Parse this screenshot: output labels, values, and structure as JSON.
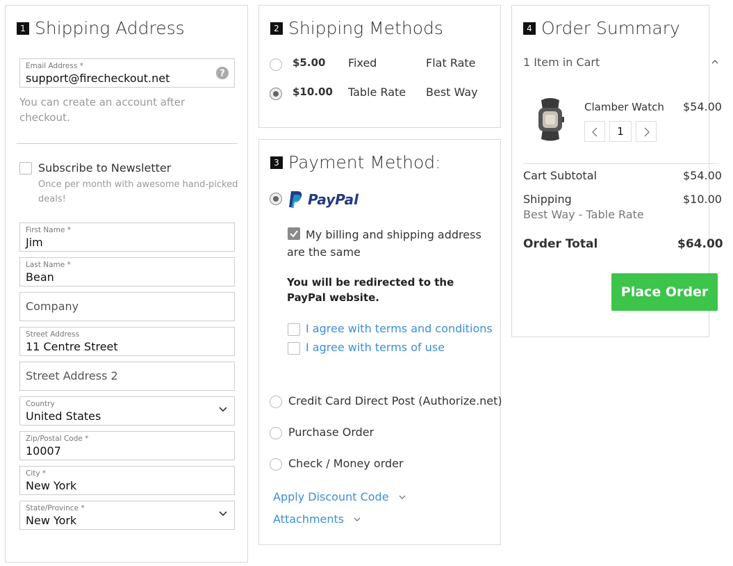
{
  "shipping_address": {
    "step": "1",
    "title": "Shipping Address",
    "email": {
      "label": "Email Address *",
      "value": "support@firecheckout.net"
    },
    "account_note": "You can create an account after checkout.",
    "newsletter": {
      "label": "Subscribe to Newsletter",
      "note": "Once per month with awesome hand-picked deals!"
    },
    "first_name": {
      "label": "First Name *",
      "value": "Jim"
    },
    "last_name": {
      "label": "Last Name *",
      "value": "Bean"
    },
    "company": {
      "placeholder": "Company"
    },
    "street": {
      "label": "Street Address",
      "value": "11 Centre Street"
    },
    "street2": {
      "placeholder": "Street Address 2"
    },
    "country": {
      "label": "Country",
      "value": "United States"
    },
    "zip": {
      "label": "Zip/Postal Code *",
      "value": "10007"
    },
    "city": {
      "label": "City *",
      "value": "New York"
    },
    "state": {
      "label": "State/Province *",
      "value": "New York"
    }
  },
  "shipping_methods": {
    "step": "2",
    "title": "Shipping Methods",
    "options": [
      {
        "price": "$5.00",
        "method": "Fixed",
        "carrier": "Flat Rate",
        "selected": false
      },
      {
        "price": "$10.00",
        "method": "Table Rate",
        "carrier": "Best Way",
        "selected": true
      }
    ]
  },
  "payment_method": {
    "step": "3",
    "title": "Payment Method:",
    "paypal": {
      "logo_text": "PayPal",
      "same_address": "My billing and shipping address are the same",
      "redirect_note": "You will be redirected to the PayPal website.",
      "agree_terms": "I agree with terms and conditions",
      "agree_use": "I agree with terms of use"
    },
    "other_methods": [
      "Credit Card Direct Post (Authorize.net)",
      "Purchase Order",
      "Check / Money order"
    ],
    "discount_link": "Apply Discount Code",
    "attachments_link": "Attachments"
  },
  "order_summary": {
    "step": "4",
    "title": "Order Summary",
    "cart_count": "1 Item in Cart",
    "item": {
      "name": "Clamber Watch",
      "price": "$54.00",
      "qty": "1"
    },
    "subtotal_label": "Cart Subtotal",
    "subtotal_value": "$54.00",
    "shipping_label": "Shipping",
    "shipping_detail": "Best Way - Table Rate",
    "shipping_value": "$10.00",
    "total_label": "Order Total",
    "total_value": "$64.00",
    "place_order": "Place Order"
  },
  "colors": {
    "accent_green": "#3cc44b",
    "link_blue": "#3d8ed8",
    "paypal_dark": "#253b80",
    "paypal_light": "#179bd7"
  },
  "icons": [
    "help-icon",
    "chevron-down-icon",
    "chevron-up-icon",
    "chevron-left-icon",
    "chevron-right-icon",
    "paypal-logo",
    "watch-image"
  ]
}
